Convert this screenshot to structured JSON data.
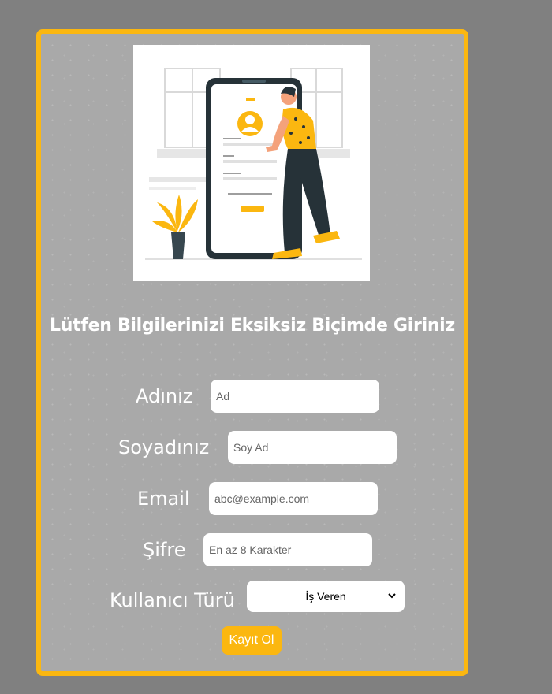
{
  "form": {
    "title": "Lütfen Bilgilerinizi Eksiksiz Biçimde Giriniz",
    "first_name": {
      "label": "Adınız",
      "placeholder": "Ad"
    },
    "last_name": {
      "label": "Soyadınız",
      "placeholder": "Soy Ad"
    },
    "email": {
      "label": "Email",
      "placeholder": "abc@example.com"
    },
    "password": {
      "label": "Şifre",
      "placeholder": "En az 8 Karakter"
    },
    "user_type": {
      "label": "Kullanıcı Türü",
      "selected": "İş Veren"
    },
    "submit_label": "Kayıt Ol"
  },
  "colors": {
    "accent": "#fbb710",
    "page_background": "#808080",
    "card_background": "#a9a9a9"
  },
  "illustration": {
    "icon": "mobile-signup-illustration"
  }
}
